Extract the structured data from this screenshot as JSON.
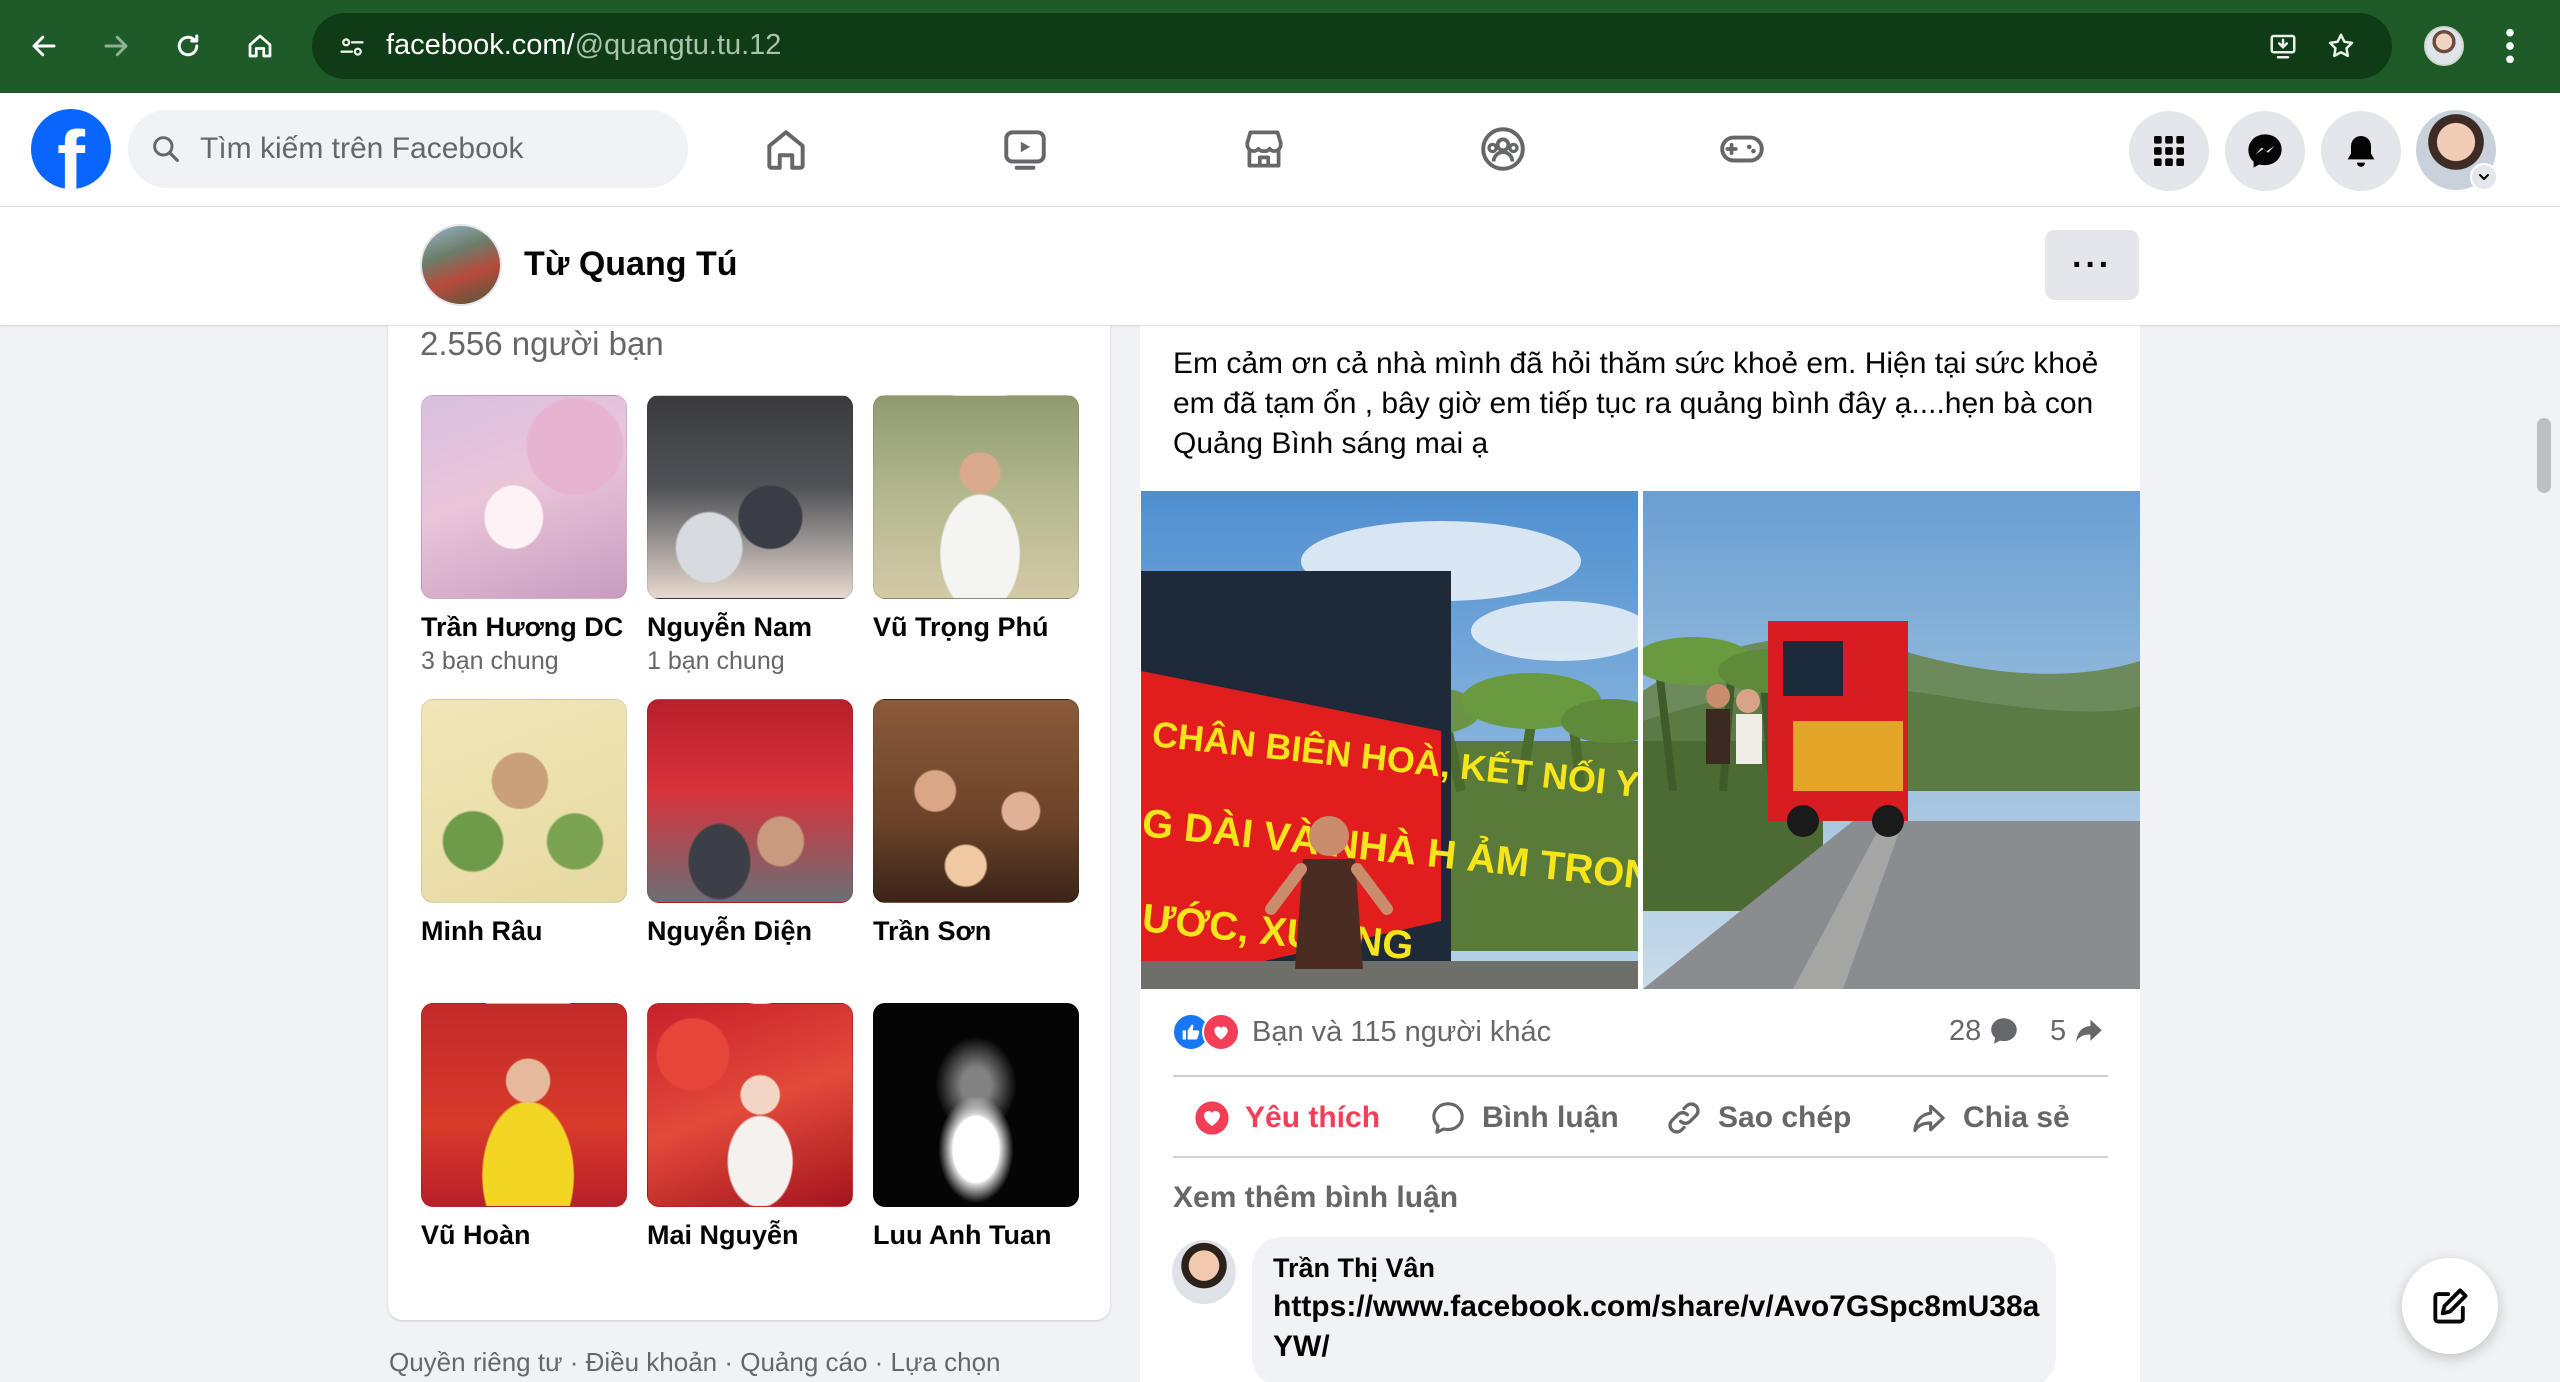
{
  "browser": {
    "url_host": "facebook.com/",
    "url_path": "@quangtu.tu.12"
  },
  "header": {
    "search_placeholder": "Tìm kiếm trên Facebook"
  },
  "profile": {
    "name": "Từ Quang Tú",
    "more_label": "···"
  },
  "friends": {
    "count": "2.556 người bạn",
    "items": [
      {
        "name": "Trần Hương DC",
        "mutual": "3 bạn chung"
      },
      {
        "name": "Nguyễn Nam",
        "mutual": "1 bạn chung"
      },
      {
        "name": "Vũ Trọng Phú",
        "mutual": ""
      },
      {
        "name": "Minh Râu",
        "mutual": ""
      },
      {
        "name": "Nguyễn Diện",
        "mutual": ""
      },
      {
        "name": "Trần Sơn",
        "mutual": ""
      },
      {
        "name": "Vũ Hoàn",
        "mutual": ""
      },
      {
        "name": "Mai Nguyễn",
        "mutual": ""
      },
      {
        "name": "Luu Anh Tuan",
        "mutual": ""
      }
    ]
  },
  "footer": {
    "links": "Quyền riêng tư · Điều khoản · Quảng cáo · Lựa chọn"
  },
  "post": {
    "text": "Em cảm ơn cả nhà mình đã hỏi thăm sức khoẻ em. Hiện tại sức khoẻ\nem đã tạm ổn , bây giờ em tiếp tục ra quảng bình đây ạ....hẹn bà con\nQuảng Bình   sáng mai ạ",
    "banner_text_1": "CHÂN BIÊN HOÀ, KẾT NỐI YÊU",
    "banner_text_2": "G DÀI VÀ NHÀ H   ẢM TRONG",
    "banner_text_3": "ƯỚC, XƯỞNG",
    "reactions_text": "Bạn và 115 người khác",
    "comments_count": "28",
    "shares_count": "5",
    "actions": {
      "love": "Yêu thích",
      "comment": "Bình luận",
      "copy": "Sao chép",
      "share": "Chia sẻ"
    },
    "see_more_comments": "Xem thêm bình luận",
    "comment": {
      "author": "Trần Thị Vân",
      "body": "https://www.facebook.com/share/v/Avo7GSpc8mU38aYW/"
    }
  },
  "colors": {
    "browser_bar": "#1e5b29",
    "facebook_blue": "#0866ff",
    "love_red": "#f33e58",
    "like_blue": "#1877f2"
  }
}
